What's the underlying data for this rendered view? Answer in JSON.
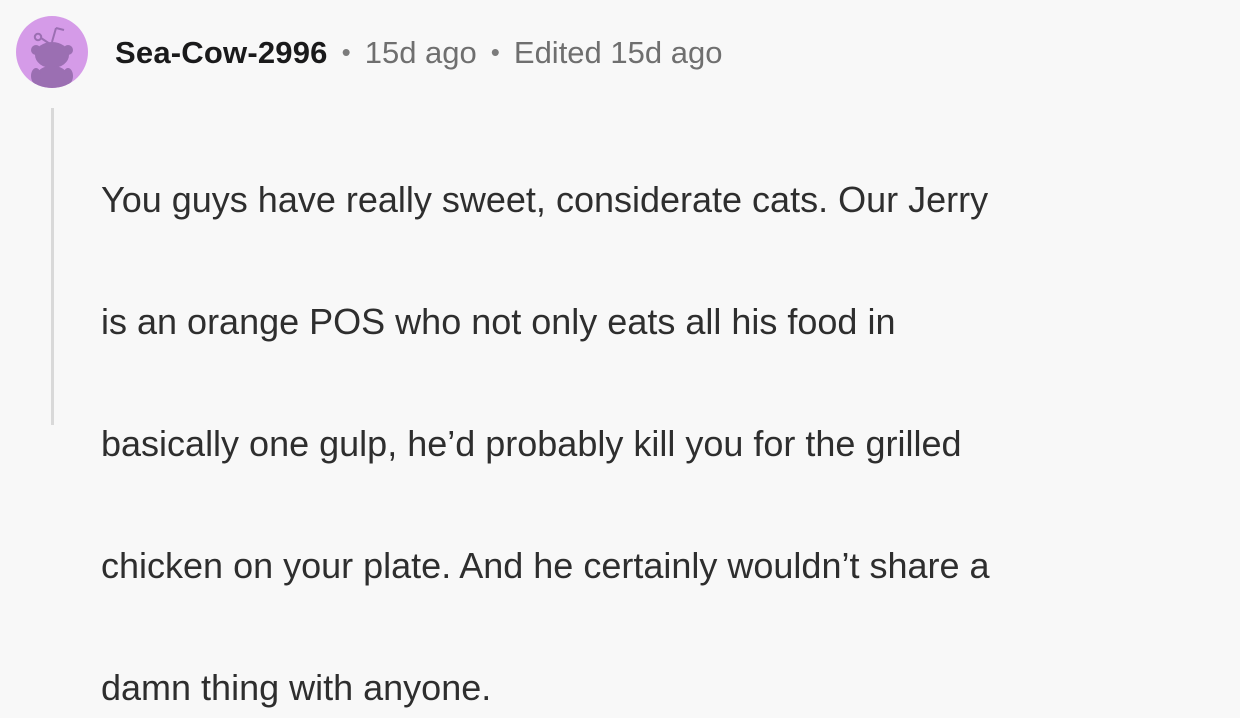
{
  "comment": {
    "author": "Sea-Cow-2996",
    "separator": "•",
    "posted": "15d ago",
    "edited": "Edited 15d ago",
    "text_lines": [
      "You guys have really sweet, considerate cats. Our Jerry",
      "is an orange POS who not only eats all his food in",
      "basically one gulp, he’d probably kill you for the grilled",
      "chicken on your plate. And he certainly wouldn’t share a",
      "damn thing with anyone."
    ]
  },
  "colors": {
    "background": "#f8f8f8",
    "avatar_background": "#d59be8",
    "avatar_figure": "#9b6fb2",
    "thread_line": "#d9d9d9"
  },
  "icons": {
    "avatar": "snoo-avatar-icon"
  }
}
